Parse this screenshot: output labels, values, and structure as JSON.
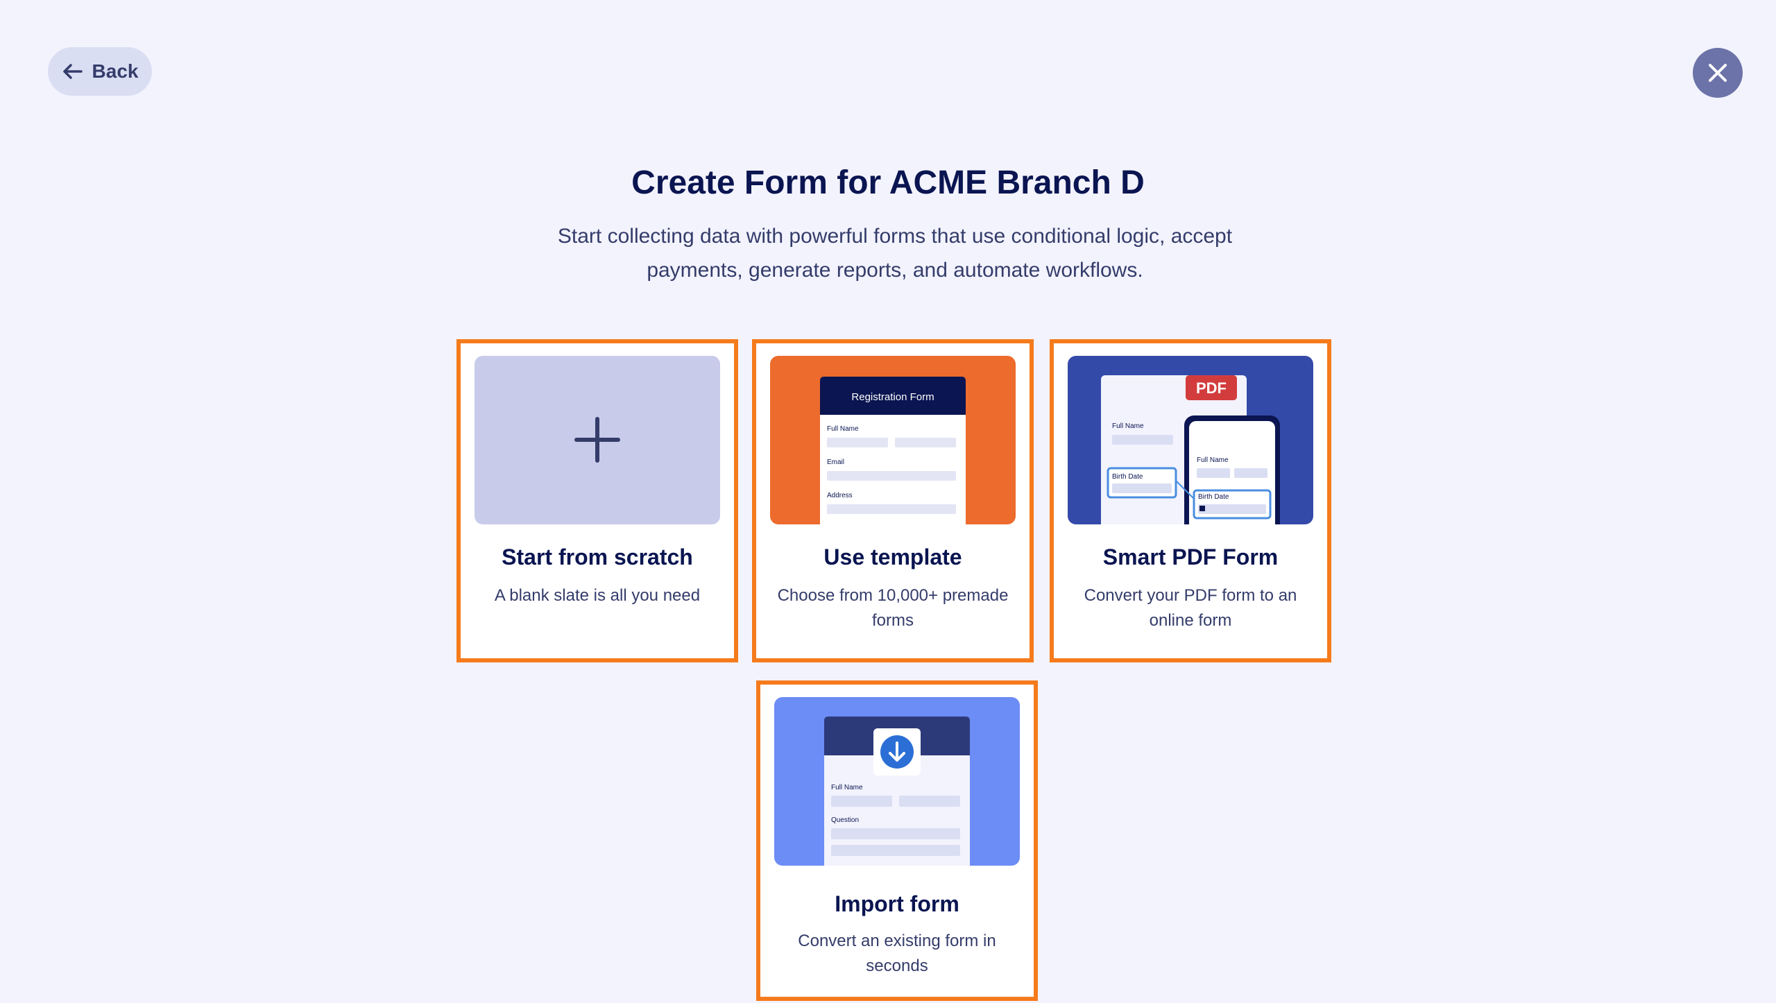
{
  "header": {
    "back_label": "Back",
    "back_icon": "arrow-left-icon",
    "close_icon": "close-icon"
  },
  "main": {
    "title": "Create Form for ACME Branch D",
    "subtitle": "Start collecting data with powerful forms that use conditional logic, accept payments, generate reports, and automate workflows."
  },
  "options": [
    {
      "title": "Start from scratch",
      "description": "A blank slate is all you need",
      "icon": "plus-icon"
    },
    {
      "title": "Use template",
      "description": "Choose from 10,000+ premade forms",
      "thumb": {
        "header": "Registration Form",
        "fields": [
          "Full Name",
          "Email",
          "Address"
        ]
      }
    },
    {
      "title": "Smart PDF Form",
      "description": "Convert your PDF form to an online form",
      "thumb": {
        "badge": "PDF",
        "doc_fields": [
          "Full Name",
          "Birth Date"
        ],
        "phone_fields": [
          "Full Name",
          "Birth Date"
        ]
      }
    },
    {
      "title": "Import form",
      "description": "Convert an existing form in seconds",
      "thumb": {
        "icon": "download-icon",
        "fields": [
          "Full Name",
          "Question"
        ]
      }
    }
  ],
  "colors": {
    "background": "#f3f3fe",
    "highlight_border": "#f57b1c",
    "scratch_thumb": "#c8cbea",
    "template_thumb": "#ec6b2d",
    "pdf_thumb": "#344aa9",
    "import_thumb": "#6c8cf6",
    "pdf_badge": "#d33c3c"
  }
}
